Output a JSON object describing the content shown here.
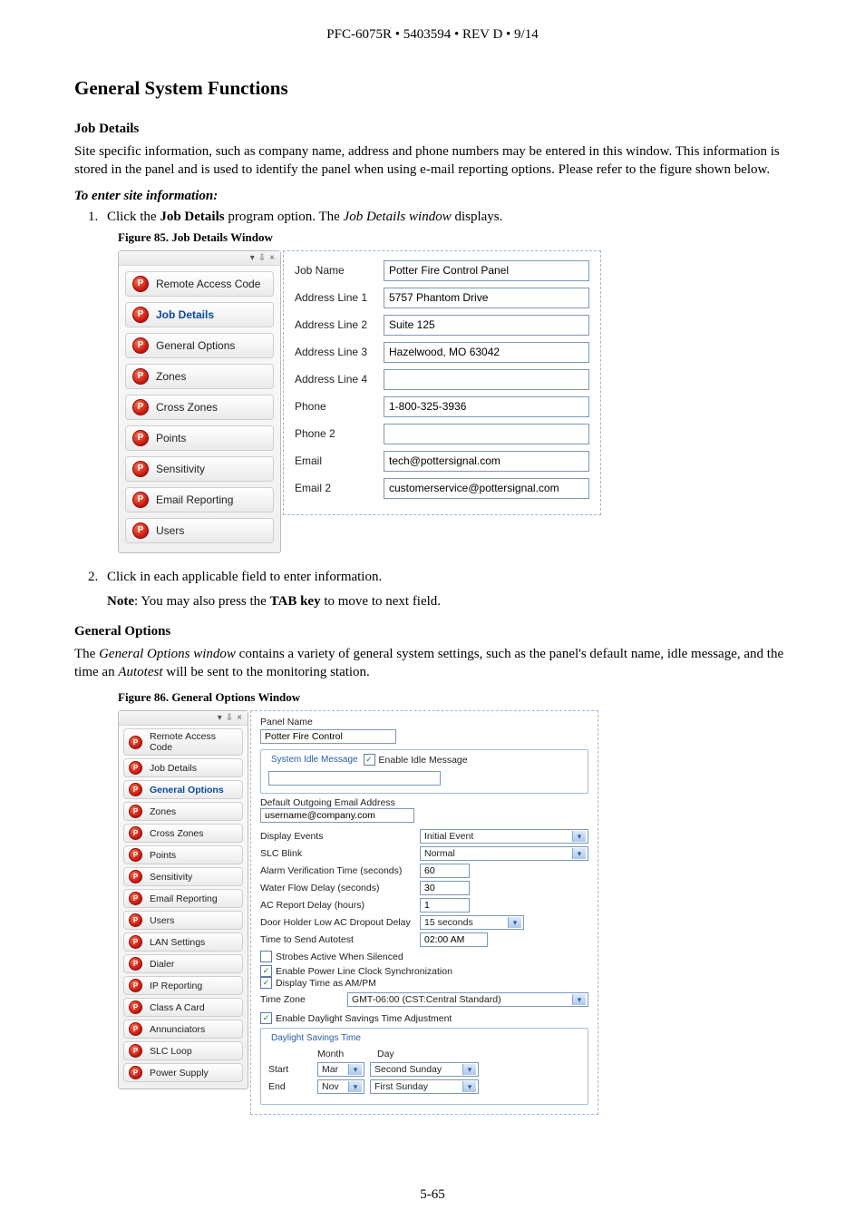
{
  "header": "PFC-6075R • 5403594 • REV D • 9/14",
  "h1": "General System Functions",
  "job_details": {
    "heading": "Job Details",
    "para": "Site specific information, such as company name, address and phone numbers may be entered in this window. This information is stored in the panel and is used to identify the panel when using e-mail reporting options. Please refer to the figure shown below.",
    "lead": "To enter site information:",
    "step1_pre": "Click the ",
    "step1_bold": "Job Details",
    "step1_mid": " program option. The ",
    "step1_italic": "Job Details window",
    "step1_post": " displays."
  },
  "fig85": {
    "caption": "Figure 85. Job Details Window",
    "nav": [
      "Remote Access Code",
      "Job Details",
      "General Options",
      "Zones",
      "Cross Zones",
      "Points",
      "Sensitivity",
      "Email Reporting",
      "Users"
    ],
    "selected": "Job Details",
    "fields": {
      "job_name": {
        "label": "Job Name",
        "value": "Potter Fire Control Panel"
      },
      "addr1": {
        "label": "Address Line 1",
        "value": "5757 Phantom Drive"
      },
      "addr2": {
        "label": "Address Line 2",
        "value": "Suite 125"
      },
      "addr3": {
        "label": "Address Line 3",
        "value": "Hazelwood, MO 63042"
      },
      "addr4": {
        "label": "Address Line 4",
        "value": ""
      },
      "phone": {
        "label": "Phone",
        "value": "1-800-325-3936"
      },
      "phone2": {
        "label": "Phone 2",
        "value": ""
      },
      "email": {
        "label": "Email",
        "value": "tech@pottersignal.com"
      },
      "email2": {
        "label": "Email 2",
        "value": "customerservice@pottersignal.com"
      }
    }
  },
  "step2": "Click in each applicable field to enter information.",
  "note_pre": "Note",
  "note_mid": ": You may also press the ",
  "note_bold": "TAB key",
  "note_post": " to move to next field.",
  "general_options": {
    "heading": "General Options",
    "para_pre": "The ",
    "para_i1": "General Options window",
    "para_mid": " contains a variety of general system settings, such as the panel's default name, idle message, and the time an ",
    "para_i2": "Autotest",
    "para_post": " will be sent to the monitoring station."
  },
  "fig86": {
    "caption": "Figure 86. General Options Window",
    "nav": [
      "Remote Access Code",
      "Job Details",
      "General Options",
      "Zones",
      "Cross Zones",
      "Points",
      "Sensitivity",
      "Email Reporting",
      "Users",
      "LAN Settings",
      "Dialer",
      "IP Reporting",
      "Class A Card",
      "Annunciators",
      "SLC Loop",
      "Power Supply"
    ],
    "selected": "General Options",
    "panel_name_label": "Panel Name",
    "panel_name": "Potter Fire Control",
    "idle_legend": "System Idle Message",
    "enable_idle": "Enable Idle Message",
    "outgoing_label": "Default Outgoing Email Address",
    "outgoing": "username@company.com",
    "display_events_label": "Display Events",
    "display_events": "Initial Event",
    "slc_blink_label": "SLC Blink",
    "slc_blink": "Normal",
    "alarm_verif_label": "Alarm Verification Time (seconds)",
    "alarm_verif": "60",
    "water_flow_label": "Water Flow Delay (seconds)",
    "water_flow": "30",
    "ac_report_label": "AC Report Delay (hours)",
    "ac_report": "1",
    "door_holder_label": "Door Holder Low AC Dropout Delay",
    "door_holder": "15 seconds",
    "autotest_label": "Time to Send Autotest",
    "autotest": "02:00 AM",
    "strobes": "Strobes Active When Silenced",
    "enable_plcs": "Enable Power Line Clock Synchronization",
    "display_ampm": "Display Time as AM/PM",
    "tz_label": "Time Zone",
    "tz": "GMT-06:00 (CST:Central Standard)",
    "enable_dst": "Enable Daylight Savings Time Adjustment",
    "dst_legend": "Daylight Savings Time",
    "dst_month": "Month",
    "dst_day": "Day",
    "dst_start": "Start",
    "dst_start_m": "Mar",
    "dst_start_d": "Second Sunday",
    "dst_end": "End",
    "dst_end_m": "Nov",
    "dst_end_d": "First Sunday"
  },
  "footer": "5-65"
}
